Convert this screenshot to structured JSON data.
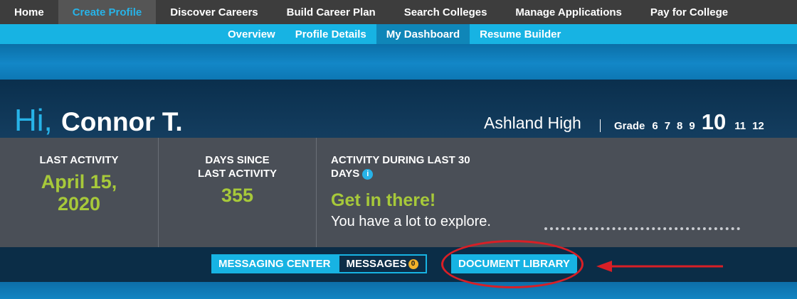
{
  "top_nav": {
    "items": [
      {
        "label": "Home",
        "active": false
      },
      {
        "label": "Create Profile",
        "active": true
      },
      {
        "label": "Discover Careers",
        "active": false
      },
      {
        "label": "Build Career Plan",
        "active": false
      },
      {
        "label": "Search Colleges",
        "active": false
      },
      {
        "label": "Manage Applications",
        "active": false
      },
      {
        "label": "Pay for College",
        "active": false
      }
    ]
  },
  "sub_nav": {
    "items": [
      {
        "label": "Overview",
        "active": false
      },
      {
        "label": "Profile Details",
        "active": false
      },
      {
        "label": "My Dashboard",
        "active": true
      },
      {
        "label": "Resume Builder",
        "active": false
      }
    ]
  },
  "greeting": {
    "hi": "Hi,",
    "name": "Connor T."
  },
  "school": "Ashland High",
  "grades": {
    "label": "Grade",
    "options": [
      "6",
      "7",
      "8",
      "9",
      "10",
      "11",
      "12"
    ],
    "current": "10"
  },
  "stats": {
    "last_activity": {
      "label": "LAST ACTIVITY",
      "value": "April 15, 2020"
    },
    "days_since": {
      "label": "DAYS SINCE LAST ACTIVITY",
      "value": "355"
    },
    "activity_30": {
      "label": "ACTIVITY DURING LAST 30 DAYS",
      "info_icon": "i",
      "headline": "Get in there!",
      "subtext": "You have a lot to explore."
    }
  },
  "actions": {
    "messaging_center": "MESSAGING CENTER",
    "messages": "MESSAGES",
    "messages_count": "0",
    "document_library": "DOCUMENT LIBRARY"
  },
  "colors": {
    "accent_blue": "#17b3e3",
    "green": "#a7c93a",
    "annotation_red": "#d81f26",
    "badge_yellow": "#f2b22a"
  }
}
